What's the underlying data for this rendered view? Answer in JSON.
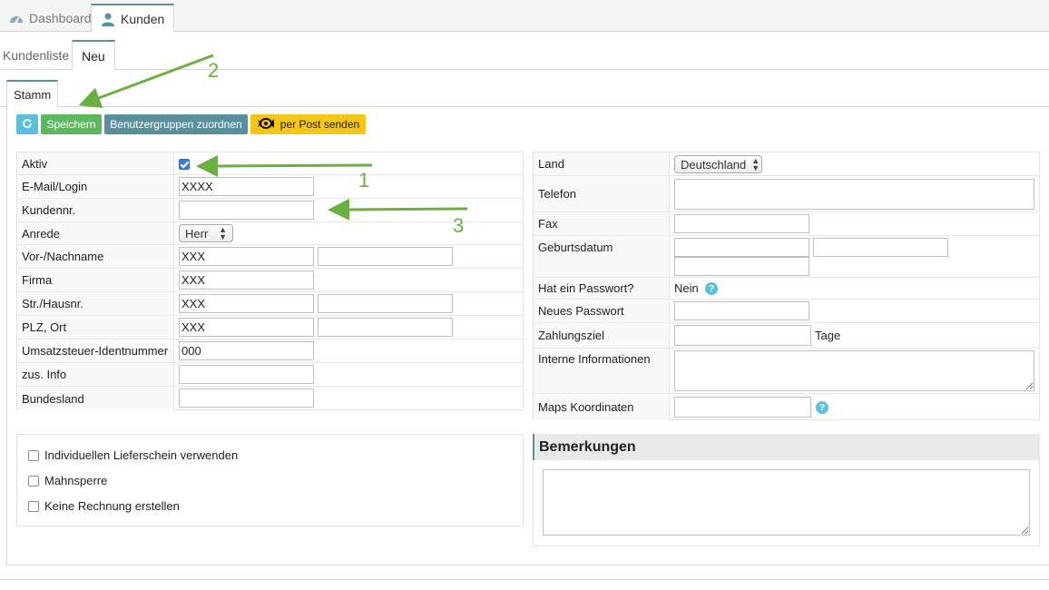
{
  "tabs_main": [
    {
      "label": "Dashboard"
    },
    {
      "label": "Kunden"
    }
  ],
  "tabs_sub": [
    {
      "label": "Kundenliste"
    },
    {
      "label": "Neu"
    }
  ],
  "tabs_section": [
    {
      "label": "Stamm"
    }
  ],
  "toolbar": {
    "save_label": "Speichern",
    "groups_label": "Benutzergruppen zuordnen",
    "post_label": "per Post senden"
  },
  "left_form": {
    "aktiv": {
      "label": "Aktiv",
      "checked": true
    },
    "email": {
      "label": "E-Mail/Login",
      "value": "XXXX"
    },
    "kundennr": {
      "label": "Kundennr.",
      "value": ""
    },
    "anrede": {
      "label": "Anrede",
      "value": "Herr"
    },
    "name": {
      "label": "Vor-/Nachname",
      "value1": "XXX",
      "value2": ""
    },
    "firma": {
      "label": "Firma",
      "value": "XXX"
    },
    "strasse": {
      "label": "Str./Hausnr.",
      "value1": "XXX",
      "value2": ""
    },
    "plz": {
      "label": "PLZ, Ort",
      "value1": "XXX",
      "value2": ""
    },
    "ust": {
      "label": "Umsatzsteuer-Identnummer",
      "value": "000"
    },
    "info": {
      "label": "zus. Info",
      "value": ""
    },
    "bundesland": {
      "label": "Bundesland",
      "value": ""
    }
  },
  "right_form": {
    "land": {
      "label": "Land",
      "value": "Deutschland"
    },
    "telefon": {
      "label": "Telefon"
    },
    "fax": {
      "label": "Fax",
      "value": ""
    },
    "geburtsdatum": {
      "label": "Geburtsdatum"
    },
    "hat_passwort": {
      "label": "Hat ein Passwort?",
      "value": "Nein"
    },
    "neues_passwort": {
      "label": "Neues Passwort"
    },
    "zahlungsziel": {
      "label": "Zahlungsziel",
      "suffix": "Tage"
    },
    "interne_info": {
      "label": "Interne Informationen"
    },
    "maps": {
      "label": "Maps Koordinaten"
    }
  },
  "options": [
    {
      "label": "Individuellen Lieferschein verwenden"
    },
    {
      "label": "Mahnsperre"
    },
    {
      "label": "Keine Rechnung erstellen"
    }
  ],
  "remarks": {
    "title": "Bemerkungen"
  },
  "annotations": {
    "one": "1",
    "two": "2",
    "three": "3"
  },
  "colors": {
    "accent": "#5a8f9e",
    "save": "#5cb85c",
    "refresh": "#5bc0de",
    "post": "#f5c518",
    "arrow": "#6aaf3f"
  }
}
